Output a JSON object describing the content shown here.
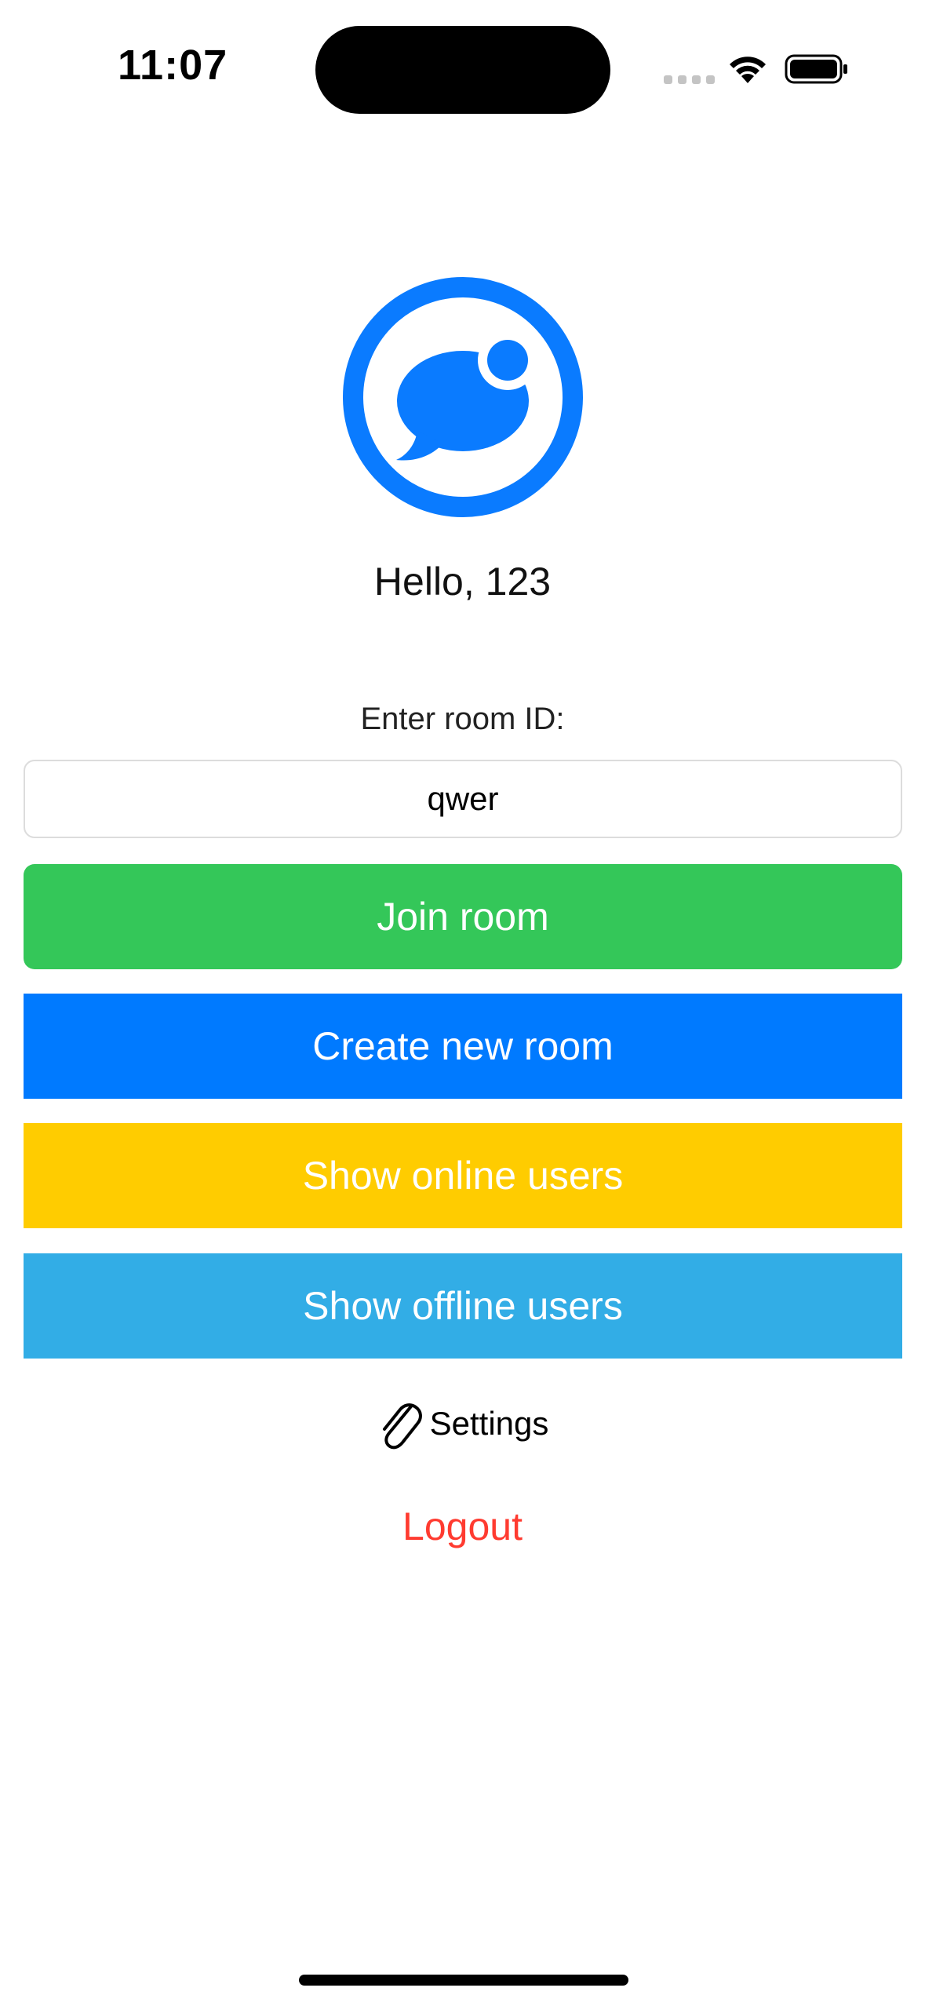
{
  "status_bar": {
    "time": "11:07",
    "icons": [
      "cellular-signal-icon",
      "wifi-icon",
      "battery-icon"
    ]
  },
  "logo": {
    "icon": "chat-bubble-icon",
    "color": "#0a7bff"
  },
  "greeting": "Hello, 123",
  "room": {
    "label": "Enter room ID:",
    "value": "qwer",
    "placeholder": ""
  },
  "buttons": {
    "join": "Join room",
    "create": "Create new room",
    "online": "Show online users",
    "offline": "Show offline users"
  },
  "settings": {
    "icon": "paperclip-icon",
    "label": "Settings"
  },
  "logout": "Logout",
  "colors": {
    "join": "#34c759",
    "create": "#007aff",
    "online": "#ffcc00",
    "offline": "#32ade6",
    "logout": "#ff3b30",
    "brand": "#0a7bff"
  }
}
